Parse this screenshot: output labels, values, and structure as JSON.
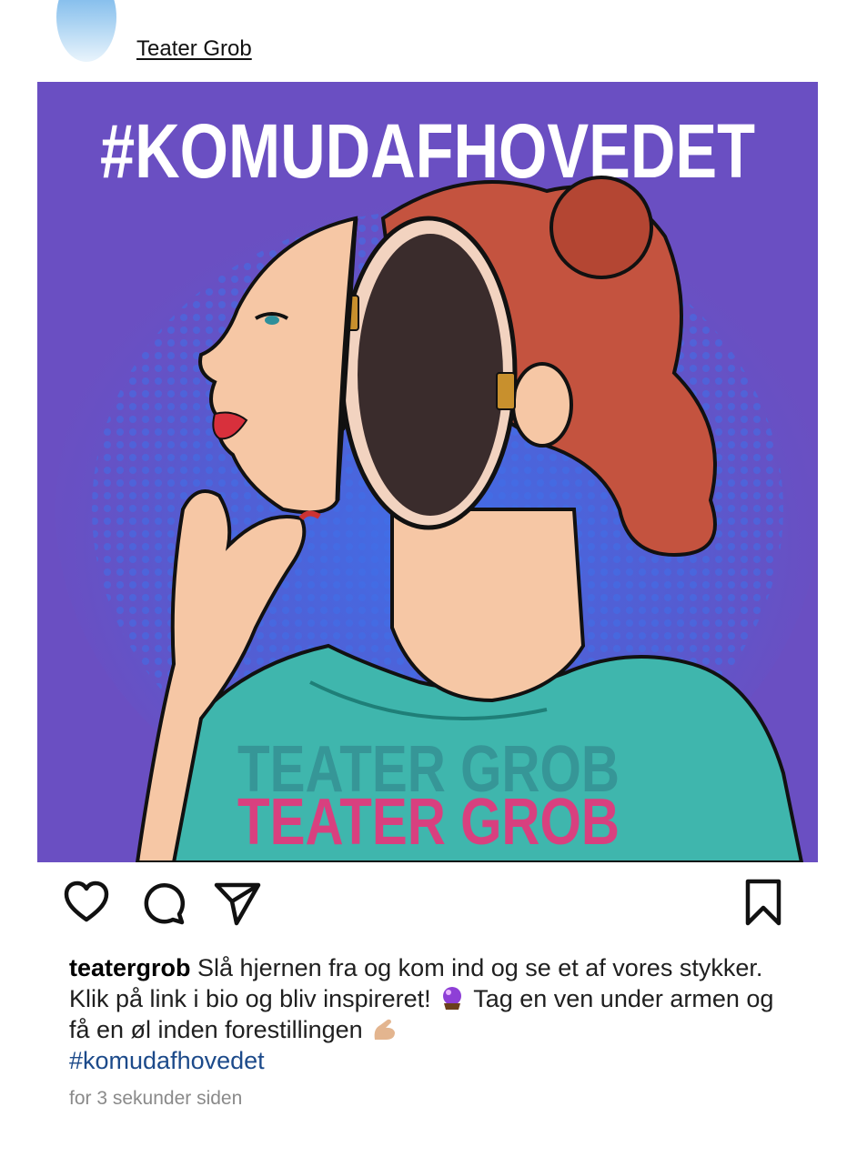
{
  "header": {
    "account_name": "Teater Grob"
  },
  "post": {
    "image_headline": "#KOMUDAFHOVEDET",
    "image_watermark": "TEATER GROB",
    "colors": {
      "background": "#6a4fc2",
      "halftone": "#3f6fe8",
      "headline": "#ffffff",
      "watermark": "#d8407f",
      "shirt": "#3fb6ad"
    }
  },
  "actions": {
    "icons": [
      "heart-icon",
      "comment-icon",
      "send-icon",
      "bookmark-icon"
    ]
  },
  "caption": {
    "username": "teatergrob",
    "text_1": " Slå hjernen fra og kom ind og se et af vores stykker. Klik på link i bio og bliv inspireret! ",
    "emoji_1": "crystal-ball",
    "text_2": " Tag en ven under armen og få en øl inden forestillingen ",
    "emoji_2": "pinching-hand",
    "hashtag": "#komudafhovedet"
  },
  "timestamp": "for 3 sekunder siden"
}
